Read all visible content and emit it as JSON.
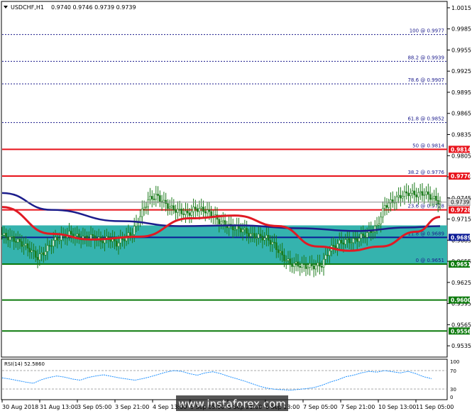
{
  "header": {
    "symbol": "USDCHF,H1",
    "ohlc": "0.9740 0.9746 0.9739 0.9739"
  },
  "price_axis": {
    "ticks": [
      "1.0015",
      "0.9985",
      "0.9955",
      "0.9925",
      "0.9895",
      "0.9865",
      "0.9835",
      "0.9805",
      "0.9775",
      "0.9745",
      "0.9715",
      "0.9685",
      "0.9655",
      "0.9625",
      "0.9595",
      "0.9565",
      "0.9535"
    ],
    "min": 0.952,
    "max": 1.0023
  },
  "fibonacci": [
    {
      "label": "100 @ 0.9977",
      "price": 0.9977
    },
    {
      "label": "88.2 @ 0.9939",
      "price": 0.9939
    },
    {
      "label": "78.6 @ 0.9907",
      "price": 0.9907
    },
    {
      "label": "61.8 @ 0.9852",
      "price": 0.9852
    },
    {
      "label": "50 @ 0.9814",
      "price": 0.9814
    },
    {
      "label": "38.2 @ 0.9776",
      "price": 0.9776
    },
    {
      "label": "23.6 @ 0.9728",
      "price": 0.9728
    },
    {
      "label": "11.8 @ 0.9689",
      "price": 0.9689
    },
    {
      "label": "0 @ 0.9651",
      "price": 0.9651
    }
  ],
  "levels": [
    {
      "price": 0.9814,
      "label": "0.9814",
      "kind": "resistance"
    },
    {
      "price": 0.9776,
      "label": "0.9776",
      "kind": "resistance"
    },
    {
      "price": 0.9728,
      "label": "0.9728",
      "kind": "resistance"
    },
    {
      "price": 0.9689,
      "label": "0.9689",
      "kind": "pivot"
    },
    {
      "price": 0.9651,
      "label": "0.9651",
      "kind": "support"
    },
    {
      "price": 0.96,
      "label": "0.9600",
      "kind": "support"
    },
    {
      "price": 0.9556,
      "label": "0.9556",
      "kind": "support"
    }
  ],
  "current_price": {
    "price": 0.9739,
    "label": "0.9739"
  },
  "zone": {
    "top": 0.9706,
    "bottom": 0.9651
  },
  "time_axis": [
    "30 Aug 2018",
    "31 Aug 13:00",
    "3 Sep 05:00",
    "3 Sep 21:00",
    "4 Sep 13:00",
    "5 Sep 05:00",
    "5 Sep 21:00",
    "6 Sep 13:00",
    "7 Sep 05:00",
    "7 Sep 21:00",
    "10 Sep 13:00",
    "11 Sep 05:00"
  ],
  "rsi": {
    "label": "RSI(14) 52.5860",
    "levels": [
      "70",
      "30"
    ],
    "axis": [
      "100",
      "0"
    ]
  },
  "watermark": "www.instaforex.com",
  "colors": {
    "zone": "#35b3ae",
    "resistance": "#e8131b",
    "support": "#0c7a0c",
    "pivot": "#0b1a96",
    "ma_blue": "#1c1d8c",
    "ma_red": "#e01a24",
    "fib": "#1a1a8c",
    "candle": "#1a7a1a"
  },
  "chart_data": {
    "type": "candlestick",
    "title": "USDCHF,H1",
    "ylabel": "",
    "xlabel": "",
    "ylim": [
      0.952,
      1.0023
    ],
    "close_path": [
      [
        0,
        0.9692
      ],
      [
        6,
        0.9686
      ],
      [
        10,
        0.968
      ],
      [
        14,
        0.9672
      ],
      [
        18,
        0.966
      ],
      [
        22,
        0.967
      ],
      [
        26,
        0.9684
      ],
      [
        30,
        0.969
      ],
      [
        34,
        0.9694
      ],
      [
        38,
        0.969
      ],
      [
        42,
        0.9688
      ],
      [
        46,
        0.969
      ],
      [
        50,
        0.9684
      ],
      [
        54,
        0.9688
      ],
      [
        58,
        0.968
      ],
      [
        62,
        0.9688
      ],
      [
        66,
        0.9696
      ],
      [
        70,
        0.972
      ],
      [
        74,
        0.9742
      ],
      [
        78,
        0.9748
      ],
      [
        82,
        0.9738
      ],
      [
        86,
        0.973
      ],
      [
        90,
        0.9726
      ],
      [
        94,
        0.9722
      ],
      [
        98,
        0.973
      ],
      [
        102,
        0.9728
      ],
      [
        106,
        0.9722
      ],
      [
        110,
        0.9712
      ],
      [
        114,
        0.9706
      ],
      [
        118,
        0.9702
      ],
      [
        122,
        0.97
      ],
      [
        126,
        0.9692
      ],
      [
        130,
        0.969
      ],
      [
        134,
        0.9688
      ],
      [
        138,
        0.9678
      ],
      [
        142,
        0.9662
      ],
      [
        146,
        0.9652
      ],
      [
        150,
        0.965
      ],
      [
        154,
        0.9648
      ],
      [
        158,
        0.9648
      ],
      [
        162,
        0.965
      ],
      [
        166,
        0.9672
      ],
      [
        170,
        0.968
      ],
      [
        174,
        0.9684
      ],
      [
        178,
        0.9684
      ],
      [
        182,
        0.969
      ],
      [
        186,
        0.9696
      ],
      [
        190,
        0.9704
      ],
      [
        194,
        0.9734
      ],
      [
        198,
        0.974
      ],
      [
        202,
        0.9748
      ],
      [
        206,
        0.9752
      ],
      [
        210,
        0.975
      ],
      [
        214,
        0.9752
      ],
      [
        218,
        0.9745
      ],
      [
        222,
        0.9739
      ]
    ],
    "blue_ma": [
      [
        0,
        0.9752
      ],
      [
        25,
        0.9728
      ],
      [
        60,
        0.9712
      ],
      [
        90,
        0.9705
      ],
      [
        120,
        0.9706
      ],
      [
        150,
        0.9702
      ],
      [
        180,
        0.9698
      ],
      [
        205,
        0.9703
      ],
      [
        222,
        0.9705
      ]
    ],
    "red_ma": [
      [
        0,
        0.9732
      ],
      [
        25,
        0.9694
      ],
      [
        45,
        0.9686
      ],
      [
        70,
        0.969
      ],
      [
        95,
        0.9716
      ],
      [
        118,
        0.972
      ],
      [
        140,
        0.9705
      ],
      [
        160,
        0.9676
      ],
      [
        176,
        0.967
      ],
      [
        192,
        0.9676
      ],
      [
        210,
        0.9697
      ],
      [
        222,
        0.9718
      ]
    ],
    "rsi_series": [
      55,
      52,
      48,
      44,
      41,
      50,
      56,
      60,
      57,
      52,
      49,
      56,
      60,
      63,
      59,
      55,
      52,
      49,
      53,
      58,
      64,
      70,
      74,
      72,
      66,
      62,
      68,
      71,
      66,
      59,
      53,
      47,
      40,
      33,
      28,
      25,
      24,
      23,
      25,
      27,
      30,
      36,
      44,
      50,
      58,
      62,
      68,
      72,
      70,
      74,
      71,
      68,
      72,
      66,
      58,
      53
    ]
  }
}
